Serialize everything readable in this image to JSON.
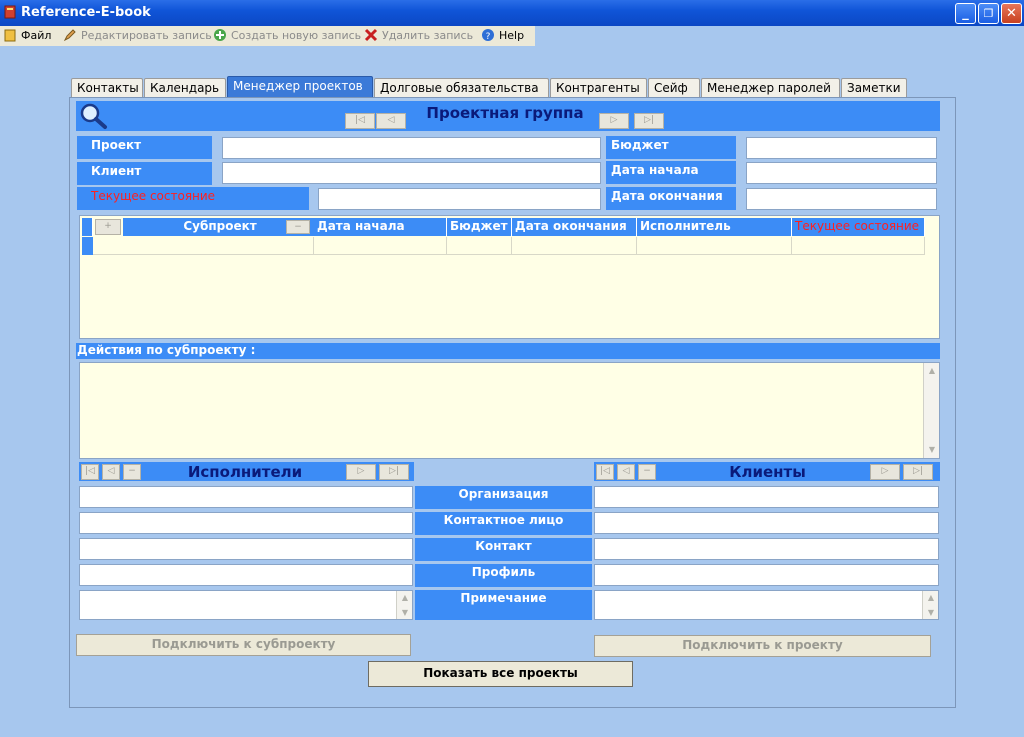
{
  "window": {
    "title": "Reference-E-book",
    "minimize": "_",
    "maximize": "❐",
    "close": "✕"
  },
  "menu": {
    "file": "Файл",
    "edit": "Редактировать запись",
    "create": "Создать новую запись",
    "delete": "Удалить запись",
    "help": "Help"
  },
  "tabs": [
    "Контакты",
    "Календарь",
    "Менеджер проектов",
    "Долговые обязательства",
    "Контрагенты",
    "Сейф",
    "Менеджер паролей",
    "Заметки"
  ],
  "project_group": {
    "title": "Проектная группа",
    "nav": {
      "first": "|◁",
      "prev": "◁",
      "next": "▷",
      "last": "▷|"
    },
    "fields": {
      "project": "Проект",
      "client": "Клиент",
      "state": "Текущее состояние",
      "budget": "Бюджет",
      "start_date": "Дата начала",
      "end_date": "Дата окончания"
    }
  },
  "grid": {
    "col_add": "+",
    "col_sub": "−",
    "columns": [
      "Субпроект",
      "Дата начала",
      "Бюджет",
      "Дата окончания",
      "Исполнитель",
      "Текущее состояние"
    ]
  },
  "actions": {
    "label": "Действия по субпроекту :"
  },
  "executors": {
    "title": "Исполнители",
    "nav": {
      "first": "|◁",
      "prev": "◁",
      "minus": "−",
      "next": "▷",
      "last": "▷|"
    }
  },
  "clients": {
    "title": "Клиенты"
  },
  "center_labels": [
    "Организация",
    "Контактное лицо",
    "Контакт",
    "Профиль",
    "Примечание"
  ],
  "buttons": {
    "attach_subproject": "Подключить к субпроекту",
    "attach_project": "Подключить к проекту",
    "show_all": "Показать все проекты"
  },
  "colors": {
    "accent": "#3c8cf6",
    "background": "#a7c7ee",
    "grid_bg": "#ffffe6",
    "state_label": "#ff2020"
  }
}
